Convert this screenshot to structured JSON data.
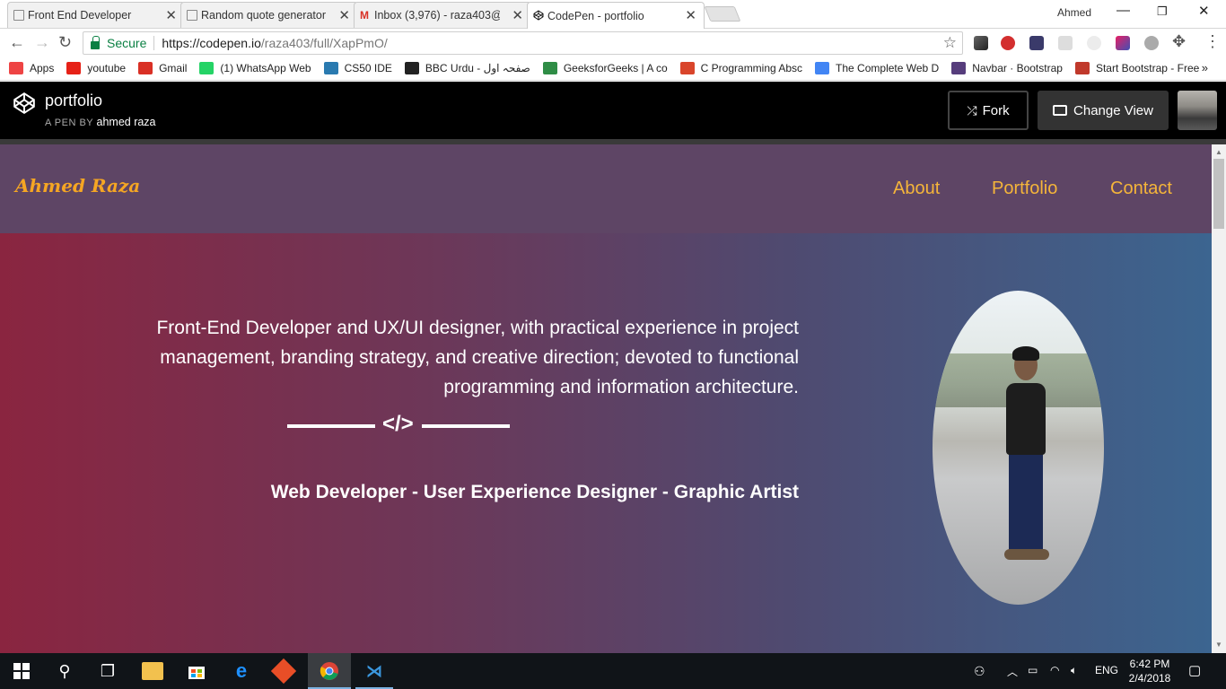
{
  "browser": {
    "tabs": [
      {
        "title": "Front End Developer",
        "active": false
      },
      {
        "title": "Random quote generator",
        "active": false
      },
      {
        "title": "Inbox (3,976) - raza403@",
        "active": false
      },
      {
        "title": "CodePen - portfolio",
        "active": true
      }
    ],
    "profile_name": "Ahmed",
    "secure_label": "Secure",
    "url_host": "https://codepen.io",
    "url_path": "/raza403/full/XapPmO/",
    "bookmarks": [
      {
        "label": "Apps",
        "icon": "apps-grid-icon",
        "color": "#e44"
      },
      {
        "label": "youtube",
        "icon": "youtube-icon",
        "color": "#e62117"
      },
      {
        "label": "Gmail",
        "icon": "gmail-icon",
        "color": "#d93025"
      },
      {
        "label": "(1) WhatsApp Web",
        "icon": "whatsapp-icon",
        "color": "#25d366"
      },
      {
        "label": "CS50 IDE",
        "icon": "cs50-icon",
        "color": "#2a7ab0"
      },
      {
        "label": "BBC Urdu - صفحہ اول",
        "icon": "bbc-icon",
        "color": "#222"
      },
      {
        "label": "GeeksforGeeks | A co",
        "icon": "geeksforgeeks-icon",
        "color": "#2f8d46"
      },
      {
        "label": "C Programming Absc",
        "icon": "pdf-icon",
        "color": "#d9452b"
      },
      {
        "label": "The Complete Web D",
        "icon": "docs-icon",
        "color": "#4285f4"
      },
      {
        "label": "Navbar · Bootstrap",
        "icon": "bootstrap-icon",
        "color": "#563d7c"
      },
      {
        "label": "Start Bootstrap - Free",
        "icon": "startbootstrap-icon",
        "color": "#c0392b"
      }
    ],
    "bookmarks_more": "»"
  },
  "codepen": {
    "title": "portfolio",
    "by_prefix": "A PEN BY",
    "author": "ahmed raza",
    "fork_label": "Fork",
    "change_view_label": "Change View"
  },
  "site": {
    "brand": "Ahmed Raza",
    "nav": [
      "About",
      "Portfolio",
      "Contact"
    ],
    "intro": "Front-End Developer and UX/UI designer, with practical experience in project management, branding strategy, and creative direction; devoted to functional programming and information architecture.",
    "divider_symbol": "</>",
    "roles": "Web Developer - User Experience Designer - Graphic Artist",
    "colors": {
      "nav_bg": "#5e4565",
      "brand": "#f5a623",
      "nav_link": "#f5b53a",
      "hero_left": "#8a2540",
      "hero_right": "#3c6590"
    }
  },
  "taskbar": {
    "language": "ENG",
    "time": "6:42 PM",
    "date": "2/4/2018"
  }
}
